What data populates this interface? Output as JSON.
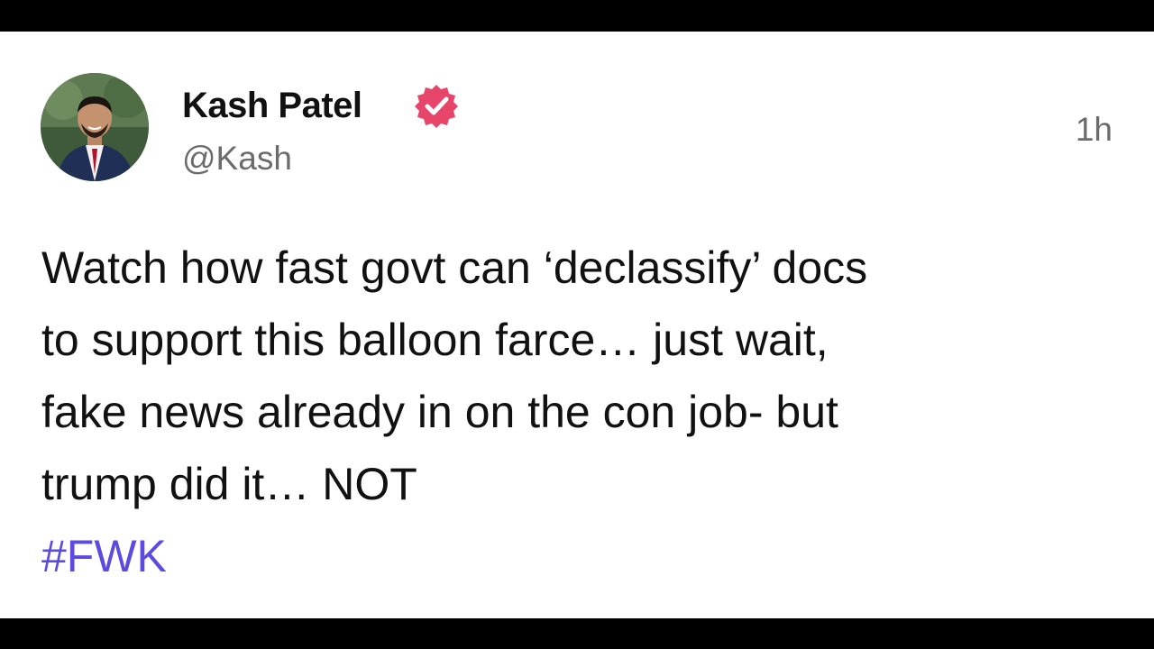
{
  "post": {
    "author_name": "Kash Patel",
    "author_handle": "@Kash",
    "timestamp": "1h",
    "verified_color": "#e8456b",
    "body_lines": [
      "Watch how fast govt can ‘declassify’ docs",
      "to support this balloon farce… just wait,",
      "fake news already in on the con job- but",
      "trump did it… NOT"
    ],
    "hashtag": "#FWK",
    "hashtag_color": "#5b4be0"
  }
}
